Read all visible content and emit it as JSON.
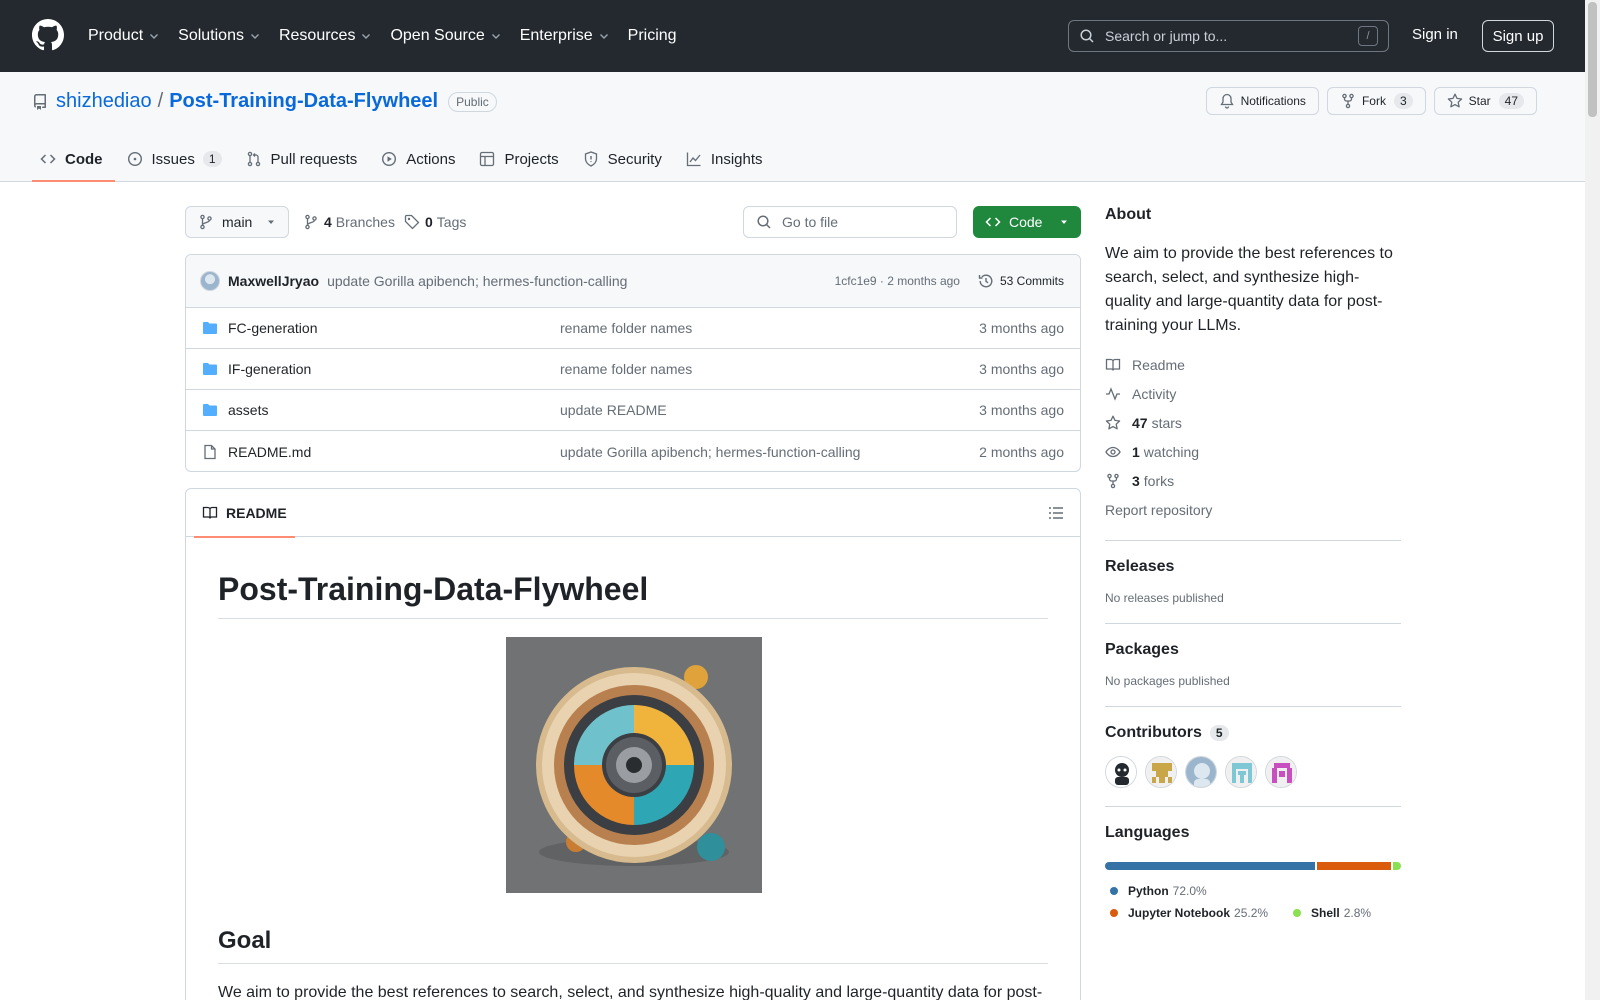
{
  "header": {
    "nav": [
      "Product",
      "Solutions",
      "Resources",
      "Open Source",
      "Enterprise",
      "Pricing"
    ],
    "search_placeholder": "Search or jump to...",
    "search_shortcut": "/",
    "signin": "Sign in",
    "signup": "Sign up"
  },
  "repo": {
    "owner": "shizhediao",
    "separator": "/",
    "name": "Post-Training-Data-Flywheel",
    "visibility": "Public",
    "notifications_label": "Notifications",
    "fork_label": "Fork",
    "fork_count": "3",
    "star_label": "Star",
    "star_count": "47",
    "tabs": [
      {
        "label": "Code",
        "icon": "code-icon"
      },
      {
        "label": "Issues",
        "icon": "issue-icon",
        "count": "1"
      },
      {
        "label": "Pull requests",
        "icon": "pull-request-icon"
      },
      {
        "label": "Actions",
        "icon": "play-icon"
      },
      {
        "label": "Projects",
        "icon": "table-icon"
      },
      {
        "label": "Security",
        "icon": "shield-icon"
      },
      {
        "label": "Insights",
        "icon": "graph-icon"
      }
    ]
  },
  "toolbar": {
    "branch": "main",
    "branches_count": "4",
    "branches_label": "Branches",
    "tags_count": "0",
    "tags_label": "Tags",
    "goto_placeholder": "Go to file",
    "code_label": "Code"
  },
  "latest_commit": {
    "author": "MaxwellJryao",
    "message": "update Gorilla apibench; hermes-function-calling",
    "meta": "1cfc1e9 · 2 months ago",
    "commits_label": "53 Commits"
  },
  "files": [
    {
      "name": "FC-generation",
      "type": "folder",
      "message": "rename folder names",
      "time": "3 months ago"
    },
    {
      "name": "IF-generation",
      "type": "folder",
      "message": "rename folder names",
      "time": "3 months ago"
    },
    {
      "name": "assets",
      "type": "folder",
      "message": "update README",
      "time": "3 months ago"
    },
    {
      "name": "README.md",
      "type": "file",
      "message": "update Gorilla apibench; hermes-function-calling",
      "time": "2 months ago"
    }
  ],
  "readme": {
    "tab_label": "README",
    "title": "Post-Training-Data-Flywheel",
    "goal_heading": "Goal",
    "goal_text": "We aim to provide the best references to search, select, and synthesize high-quality and large-quantity data for post-"
  },
  "about": {
    "heading": "About",
    "description": "We aim to provide the best references to search, select, and synthesize high-quality and large-quantity data for post-training your LLMs.",
    "readme_label": "Readme",
    "activity_label": "Activity",
    "stars_count": "47",
    "stars_label": "stars",
    "watching_count": "1",
    "watching_label": "watching",
    "forks_count": "3",
    "forks_label": "forks",
    "report_label": "Report repository"
  },
  "releases": {
    "heading": "Releases",
    "text": "No releases published"
  },
  "packages": {
    "heading": "Packages",
    "text": "No packages published"
  },
  "contributors": {
    "heading": "Contributors",
    "count": "5"
  },
  "languages": {
    "heading": "Languages",
    "items": [
      {
        "name": "Python",
        "pct": "72.0%",
        "value": 72.0,
        "color": "#3572A5"
      },
      {
        "name": "Jupyter Notebook",
        "pct": "25.2%",
        "value": 25.2,
        "color": "#DA5B0B"
      },
      {
        "name": "Shell",
        "pct": "2.8%",
        "value": 2.8,
        "color": "#89e051"
      }
    ]
  }
}
